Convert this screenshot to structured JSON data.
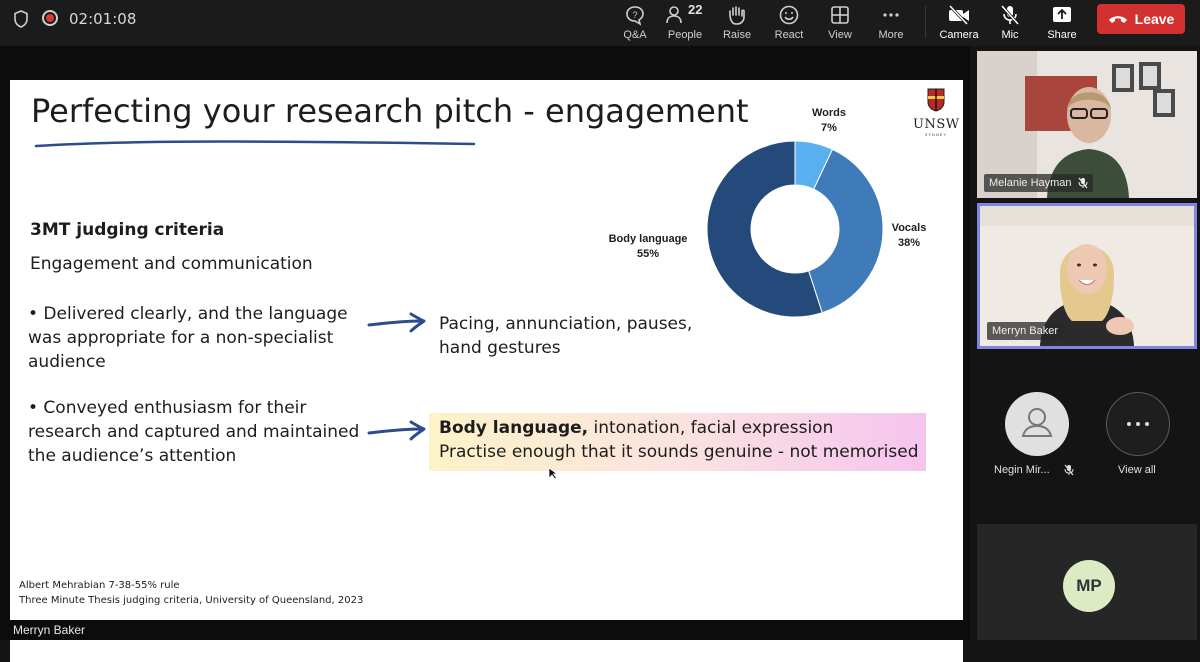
{
  "status": {
    "timer": "02:01:08"
  },
  "toolbar": {
    "qa_label": "Q&A",
    "people_label": "People",
    "people_count": "22",
    "raise_label": "Raise",
    "react_label": "React",
    "view_label": "View",
    "more_label": "More",
    "camera_label": "Camera",
    "mic_label": "Mic",
    "share_label": "Share",
    "leave_label": "Leave"
  },
  "slide": {
    "title": "Perfecting your research pitch - engagement",
    "logo_text": "UNSW",
    "logo_sub": "SYDNEY",
    "criteria_heading": "3MT judging criteria",
    "criteria_subheading": "Engagement and communication",
    "bullet1": "• Delivered clearly, and the language was appropriate for a non-specialist audience",
    "bullet2": "• Conveyed enthusiasm for their research and captured and maintained the audience’s attention",
    "pacing_text": "Pacing, annunciation, pauses, hand gestures",
    "highlight_bold": "Body language,",
    "highlight_rest": " intonation, facial expression",
    "highlight_line2": "Practise enough that it sounds genuine  - not memorised",
    "ref1": "Albert Mehrabian 7-38-55%  rule",
    "ref2": "Three Minute Thesis judging criteria, University of Queensland, 2023"
  },
  "chart_data": {
    "type": "pie",
    "categories": [
      "Words",
      "Vocals",
      "Body language"
    ],
    "values": [
      7,
      38,
      55
    ],
    "labels": [
      "7%",
      "38%",
      "55%"
    ],
    "colors": [
      "#5ab0ef",
      "#3f7bb8",
      "#244a7c"
    ],
    "donut": true
  },
  "presenter": {
    "name": "Merryn Baker"
  },
  "participants": {
    "tile1_name": "Melanie Hayman",
    "tile2_name": "Merryn Baker",
    "tile3_name": "Negin Mir...",
    "view_all_label": "View all",
    "mp_initials": "MP"
  }
}
